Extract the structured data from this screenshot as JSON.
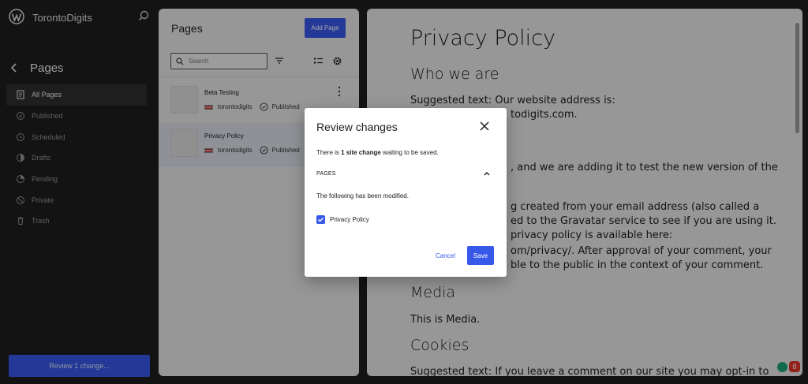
{
  "site": {
    "title": "TorontoDigits"
  },
  "sidebar": {
    "heading": "Pages",
    "items": [
      {
        "label": "All Pages",
        "icon": "pages-icon",
        "active": true
      },
      {
        "label": "Published",
        "icon": "published-icon"
      },
      {
        "label": "Scheduled",
        "icon": "scheduled-icon"
      },
      {
        "label": "Drafts",
        "icon": "drafts-icon"
      },
      {
        "label": "Pending",
        "icon": "pending-icon"
      },
      {
        "label": "Private",
        "icon": "private-icon"
      },
      {
        "label": "Trash",
        "icon": "trash-icon"
      }
    ],
    "review_button": "Review 1 change..."
  },
  "pages_panel": {
    "title": "Pages",
    "add_button": "Add Page",
    "search_placeholder": "Search",
    "rows": [
      {
        "title": "Beta Testing",
        "author": "torontodigits",
        "status": "Published"
      },
      {
        "title": "Privacy Policy",
        "author": "torontodigits",
        "status": "Published",
        "selected": true
      }
    ]
  },
  "preview": {
    "title": "Privacy Policy",
    "sections": {
      "who": "Who we are",
      "p1a": "Suggested text: Our website address is:",
      "p1b": "todigits.com.",
      "p2": ", and we are adding it to test the new version of the",
      "p3a": "g created from your email address (also called a",
      "p3b": "ed to the Gravatar service to see if you are using it.",
      "p3c": "privacy policy is available here:",
      "p3d": "om/privacy/. After approval of your comment, your",
      "p3e": "ble to the public in the context of your comment.",
      "media": "Media",
      "media_text": "This is Media.",
      "cookies": "Cookies",
      "cookies_text": "Suggested text: If you leave a comment on our site you may opt-in to"
    },
    "badge_count": "8"
  },
  "modal": {
    "title": "Review changes",
    "message_prefix": "There is ",
    "message_bold": "1 site change",
    "message_suffix": " waiting to be saved.",
    "section": "PAGES",
    "modified_text": "The following has been modified.",
    "checkbox_label": "Privacy Policy",
    "cancel": "Cancel",
    "save": "Save"
  },
  "colors": {
    "accent": "#3858e9",
    "sidebar_bg": "#1e1e1e"
  }
}
